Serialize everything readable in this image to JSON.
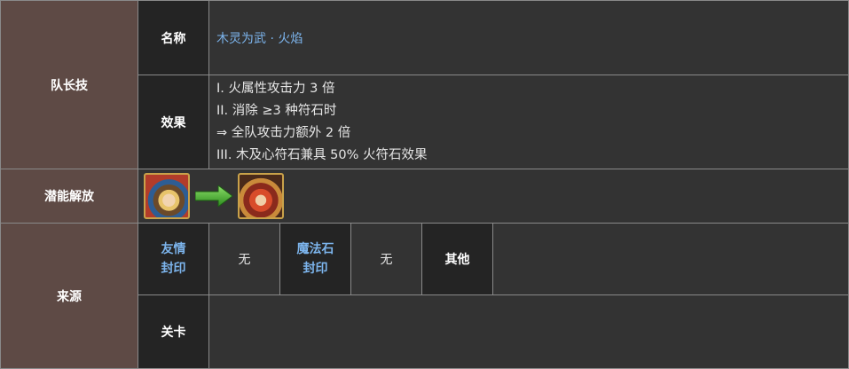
{
  "leader_skill": {
    "category": "队长技",
    "name_label": "名称",
    "name_value": "木灵为武 · 火焰",
    "effect_label": "效果",
    "effects": [
      "I. 火属性攻击力 3 倍",
      "II. 消除 ≥3 种符石时",
      "⇒ 全队攻击力额外 2 倍",
      "III. 木及心符石兼具 50% 火符石效果"
    ]
  },
  "potential": {
    "category": "潜能解放",
    "from_icon": "character-portrait-before",
    "arrow_icon": "green-arrow-right-icon",
    "to_icon": "character-portrait-after",
    "arrow_color": "#3fae2a"
  },
  "source": {
    "category": "来源",
    "friend_seal_label": "友情\n封印",
    "friend_seal_line1": "友情",
    "friend_seal_line2": "封印",
    "friend_seal_value": "无",
    "diamond_seal_line1": "魔法石",
    "diamond_seal_line2": "封印",
    "diamond_seal_value": "无",
    "other_label": "其他",
    "other_value": "",
    "stage_label": "关卡",
    "stage_value": ""
  },
  "colors": {
    "category_bg": "#5e4a45",
    "label_bg": "#242424",
    "value_bg": "#333333",
    "link_blue": "#7cb4ec"
  }
}
